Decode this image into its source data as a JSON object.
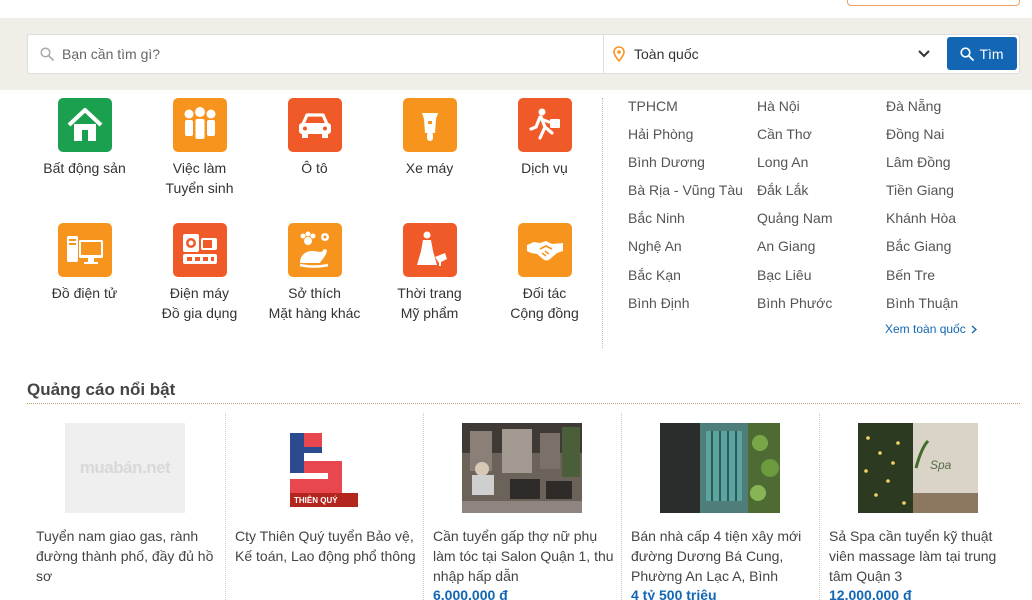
{
  "search": {
    "placeholder": "Bạn cần tìm gì?",
    "location": "Toàn quốc",
    "button_label": "Tìm"
  },
  "categories": [
    {
      "line1": "Bất động sản",
      "line2": "",
      "icon": "house-icon",
      "color": "#1aa04e"
    },
    {
      "line1": "Việc làm",
      "line2": "Tuyển sinh",
      "icon": "people-icon",
      "color": "#f7941d"
    },
    {
      "line1": "Ô tô",
      "line2": "",
      "icon": "car-icon",
      "color": "#f05a28"
    },
    {
      "line1": "Xe máy",
      "line2": "",
      "icon": "scooter-icon",
      "color": "#f7941d"
    },
    {
      "line1": "Dịch vụ",
      "line2": "",
      "icon": "running-man-icon",
      "color": "#f05a28"
    },
    {
      "line1": "Đồ điện tử",
      "line2": "",
      "icon": "computer-icon",
      "color": "#f7941d"
    },
    {
      "line1": "Điện máy",
      "line2": "Đồ gia dụng",
      "icon": "appliances-icon",
      "color": "#f05a28"
    },
    {
      "line1": "Sở thích",
      "line2": "Mặt hàng khác",
      "icon": "hobby-icon",
      "color": "#f7941d"
    },
    {
      "line1": "Thời trang",
      "line2": "Mỹ phẩm",
      "icon": "fashion-icon",
      "color": "#f05a28"
    },
    {
      "line1": "Đối tác",
      "line2": "Cộng đồng",
      "icon": "handshake-icon",
      "color": "#f7941d"
    }
  ],
  "cities": [
    [
      "TPHCM",
      "Hà Nội",
      "Đà Nẵng"
    ],
    [
      "Hải Phòng",
      "Cần Thơ",
      "Đồng Nai"
    ],
    [
      "Bình Dương",
      "Long An",
      "Lâm Đồng"
    ],
    [
      "Bà Rịa - Vũng Tàu",
      "Đắk Lắk",
      "Tiền Giang"
    ],
    [
      "Bắc Ninh",
      "Quảng Nam",
      "Khánh Hòa"
    ],
    [
      "Nghệ An",
      "An Giang",
      "Bắc Giang"
    ],
    [
      "Bắc Kạn",
      "Bạc Liêu",
      "Bến Tre"
    ],
    [
      "Bình Định",
      "Bình Phước",
      "Bình Thuận"
    ]
  ],
  "see_all": "Xem toàn quốc",
  "featured": {
    "title": "Quảng cáo nổi bật",
    "ads": [
      {
        "title": "Tuyển nam giao gas, rành đường thành phố, đầy đủ hồ sơ",
        "price": "",
        "thumb": "muaban-logo",
        "logo_text": "muabán.net"
      },
      {
        "title": "Cty Thiên Quý tuyển Bảo vệ, Kế toán, Lao động phổ thông",
        "price": "",
        "thumb": "thien-quy-logo",
        "logo_text": "THIÊN QUÝ"
      },
      {
        "title": "Cần tuyển gấp thợ nữ phụ làm tóc tại Salon Quận 1, thu nhập hấp dẫn",
        "price": "6.000.000 đ",
        "thumb": "salon-photo"
      },
      {
        "title": "Bán nhà cấp 4 tiện xây mới đường Dương Bá Cung, Phường An Lạc A, Bình",
        "price": "4 tỷ 500 triệu",
        "thumb": "house-photo"
      },
      {
        "title": "Sả Spa cần tuyển kỹ thuật viên massage làm tại trung tâm Quận 3",
        "price": "12.000.000 đ",
        "thumb": "spa-photo",
        "logo_text": "Spa"
      }
    ]
  }
}
